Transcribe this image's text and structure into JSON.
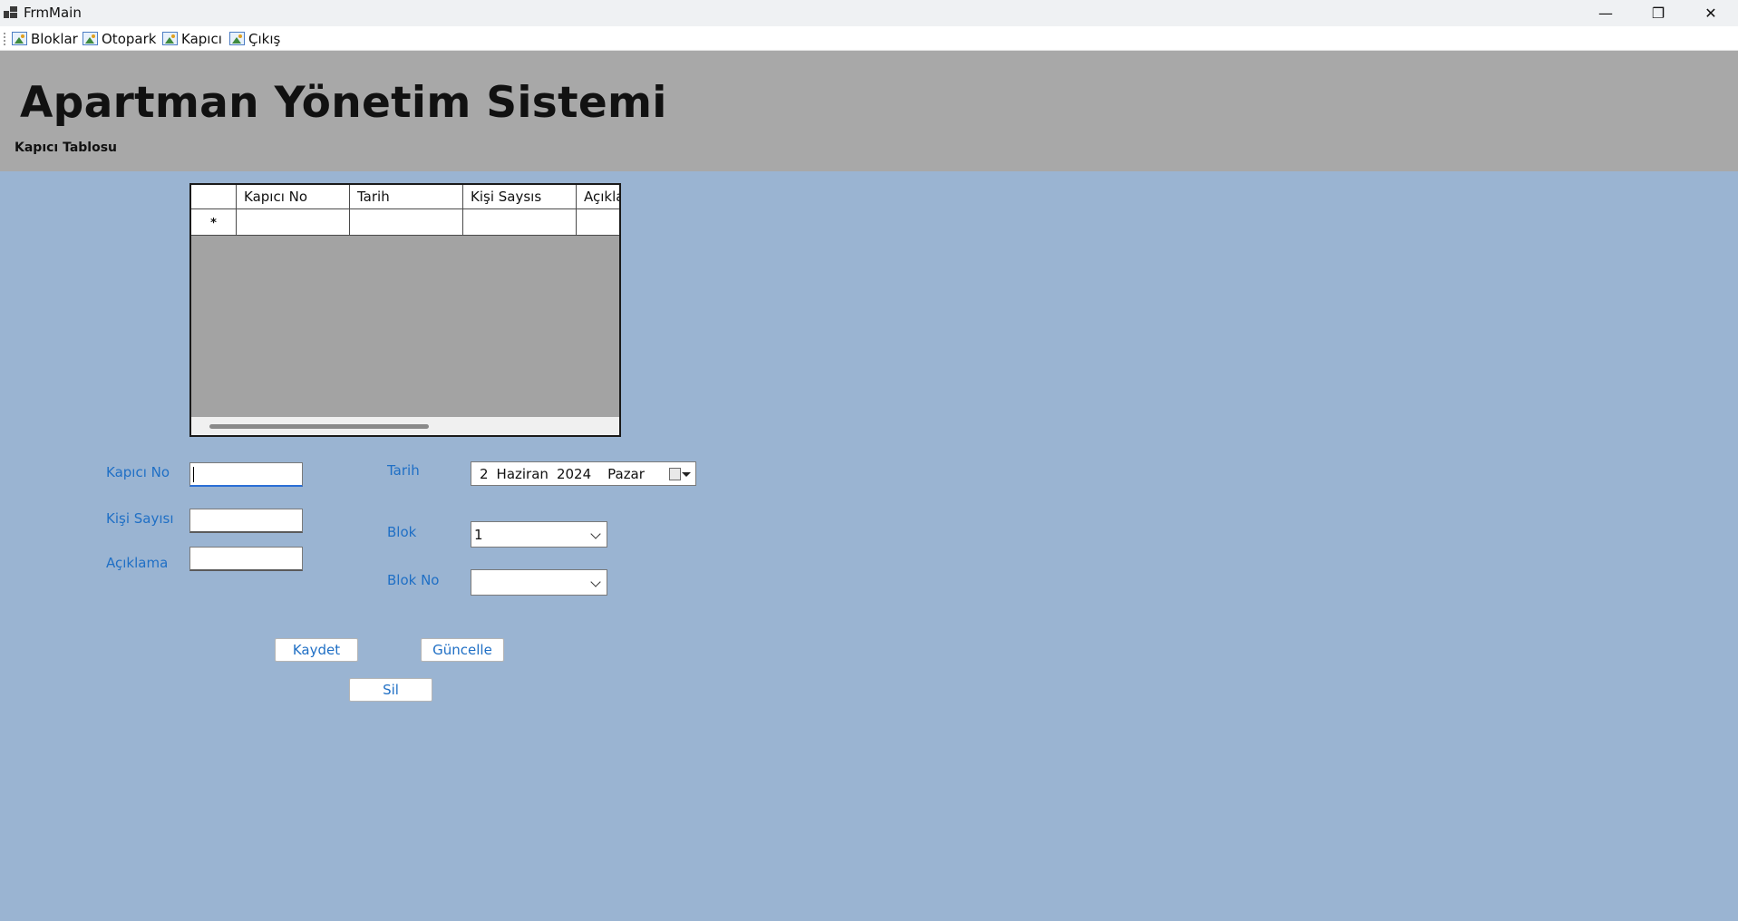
{
  "window": {
    "title": "FrmMain",
    "minimize": "—",
    "maximize": "❐",
    "close": "✕"
  },
  "menu": {
    "items": [
      {
        "label": "Bloklar",
        "icon": "image-icon"
      },
      {
        "label": "Otopark",
        "icon": "image-icon"
      },
      {
        "label": "Kapıcı",
        "icon": "image-icon"
      },
      {
        "label": "Çıkış",
        "icon": "image-icon"
      }
    ]
  },
  "header": {
    "title": "Apartman Yönetim Sistemi",
    "subtitle": "Kapıcı Tablosu",
    "background": "#a8a8a8"
  },
  "grid": {
    "columns": [
      "Kapıcı No",
      "Tarih",
      "Kişi Saysıs",
      "Açıkla"
    ],
    "new_row_marker": "*"
  },
  "form": {
    "kapici_no_label": "Kapıcı No",
    "kapici_no_value": "",
    "kisi_sayisi_label": "Kişi Sayısı",
    "kisi_sayisi_value": "",
    "aciklama_label": "Açıklama",
    "aciklama_value": "",
    "tarih_label": "Tarih",
    "tarih": {
      "day": "2",
      "month": "Haziran",
      "year": "2024",
      "weekday": "Pazar"
    },
    "blok_label": "Blok",
    "blok_value": "1",
    "blok_no_label": "Blok No",
    "blok_no_value": ""
  },
  "buttons": {
    "kaydet": "Kaydet",
    "guncelle": "Güncelle",
    "sil": "Sil"
  },
  "colors": {
    "background": "#9ab4d2",
    "label": "#1f6fc5"
  }
}
